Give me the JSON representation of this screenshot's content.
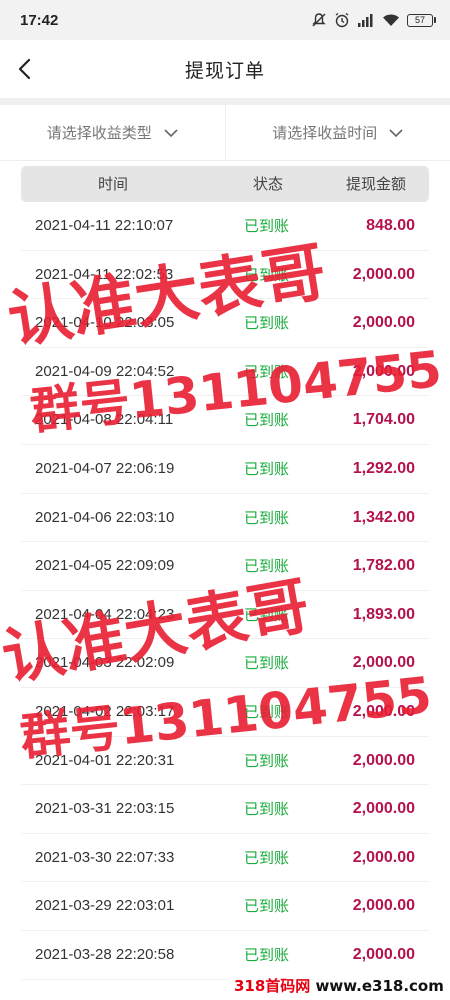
{
  "status_bar": {
    "time": "17:42",
    "battery": "57",
    "icons": [
      "mute-icon",
      "alarm-icon",
      "hd-signal-icon",
      "wifi-icon",
      "battery-icon"
    ]
  },
  "navbar": {
    "title": "提现订单",
    "back_icon": "chevron-left-icon"
  },
  "filters": {
    "type_label": "请选择收益类型",
    "time_label": "请选择收益时间"
  },
  "table": {
    "headers": {
      "time": "时间",
      "status": "状态",
      "amount": "提现金额"
    },
    "rows": [
      {
        "time": "2021-04-11 22:10:07",
        "status": "已到账",
        "amount": "848.00"
      },
      {
        "time": "2021-04-11 22:02:53",
        "status": "已到账",
        "amount": "2,000.00"
      },
      {
        "time": "2021-04-10 22:03:05",
        "status": "已到账",
        "amount": "2,000.00"
      },
      {
        "time": "2021-04-09 22:04:52",
        "status": "已到账",
        "amount": "2,000.00"
      },
      {
        "time": "2021-04-08 22:04:11",
        "status": "已到账",
        "amount": "1,704.00"
      },
      {
        "time": "2021-04-07 22:06:19",
        "status": "已到账",
        "amount": "1,292.00"
      },
      {
        "time": "2021-04-06 22:03:10",
        "status": "已到账",
        "amount": "1,342.00"
      },
      {
        "time": "2021-04-05 22:09:09",
        "status": "已到账",
        "amount": "1,782.00"
      },
      {
        "time": "2021-04-04 22:04:23",
        "status": "已到账",
        "amount": "1,893.00"
      },
      {
        "time": "2021-04-03 22:02:09",
        "status": "已到账",
        "amount": "2,000.00"
      },
      {
        "time": "2021-04-02 22:03:17",
        "status": "已到账",
        "amount": "2,000.00"
      },
      {
        "time": "2021-04-01 22:20:31",
        "status": "已到账",
        "amount": "2,000.00"
      },
      {
        "time": "2021-03-31 22:03:15",
        "status": "已到账",
        "amount": "2,000.00"
      },
      {
        "time": "2021-03-30 22:07:33",
        "status": "已到账",
        "amount": "2,000.00"
      },
      {
        "time": "2021-03-29 22:03:01",
        "status": "已到账",
        "amount": "2,000.00"
      },
      {
        "time": "2021-03-28 22:20:58",
        "status": "已到账",
        "amount": "2,000.00"
      }
    ]
  },
  "watermark": {
    "line1": "认准大表哥",
    "line2": "群号131104755"
  },
  "footer_logo": {
    "part1": "318首码网",
    "part2": " www.e318.com"
  }
}
